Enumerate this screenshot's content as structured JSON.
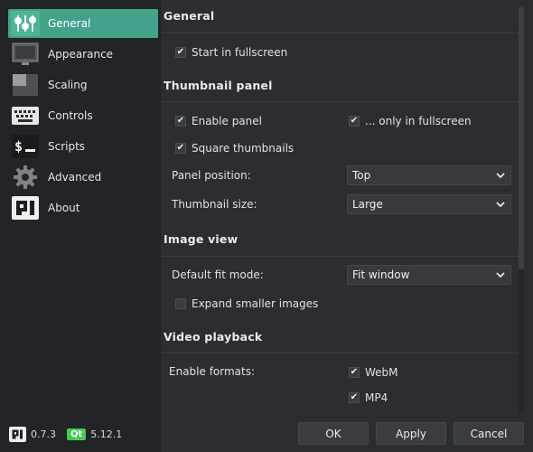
{
  "sidebar": {
    "items": [
      {
        "label": "General",
        "icon": "sliders-icon"
      },
      {
        "label": "Appearance",
        "icon": "monitor-icon"
      },
      {
        "label": "Scaling",
        "icon": "scaling-icon"
      },
      {
        "label": "Controls",
        "icon": "keyboard-icon"
      },
      {
        "label": "Scripts",
        "icon": "terminal-icon"
      },
      {
        "label": "Advanced",
        "icon": "gear-icon"
      },
      {
        "label": "About",
        "icon": "qi-logo-icon"
      }
    ],
    "active_index": 0
  },
  "version": {
    "app_version": "0.7.3",
    "qt_label": "Qt",
    "qt_version": "5.12.1"
  },
  "general": {
    "title": "General",
    "start_fullscreen": {
      "label": "Start in fullscreen",
      "checked": true
    }
  },
  "thumbnail_panel": {
    "title": "Thumbnail panel",
    "enable_panel": {
      "label": "Enable panel",
      "checked": true
    },
    "only_fullscreen": {
      "label": "... only in fullscreen",
      "checked": true
    },
    "square_thumbnails": {
      "label": "Square thumbnails",
      "checked": true
    },
    "panel_position": {
      "label": "Panel position:",
      "value": "Top"
    },
    "thumbnail_size": {
      "label": "Thumbnail size:",
      "value": "Large"
    }
  },
  "image_view": {
    "title": "Image view",
    "fit_mode": {
      "label": "Default fit mode:",
      "value": "Fit window"
    },
    "expand_smaller": {
      "label": "Expand smaller images",
      "checked": false
    }
  },
  "video_playback": {
    "title": "Video playback",
    "formats_label": "Enable formats:",
    "webm": {
      "label": "WebM",
      "checked": true
    },
    "mp4": {
      "label": "MP4",
      "checked": true
    }
  },
  "buttons": {
    "ok": "OK",
    "apply": "Apply",
    "cancel": "Cancel"
  },
  "colors": {
    "accent": "#44a28a",
    "background": "#2b2d31",
    "sidebar": "#232427",
    "qt_green": "#41cd52"
  }
}
